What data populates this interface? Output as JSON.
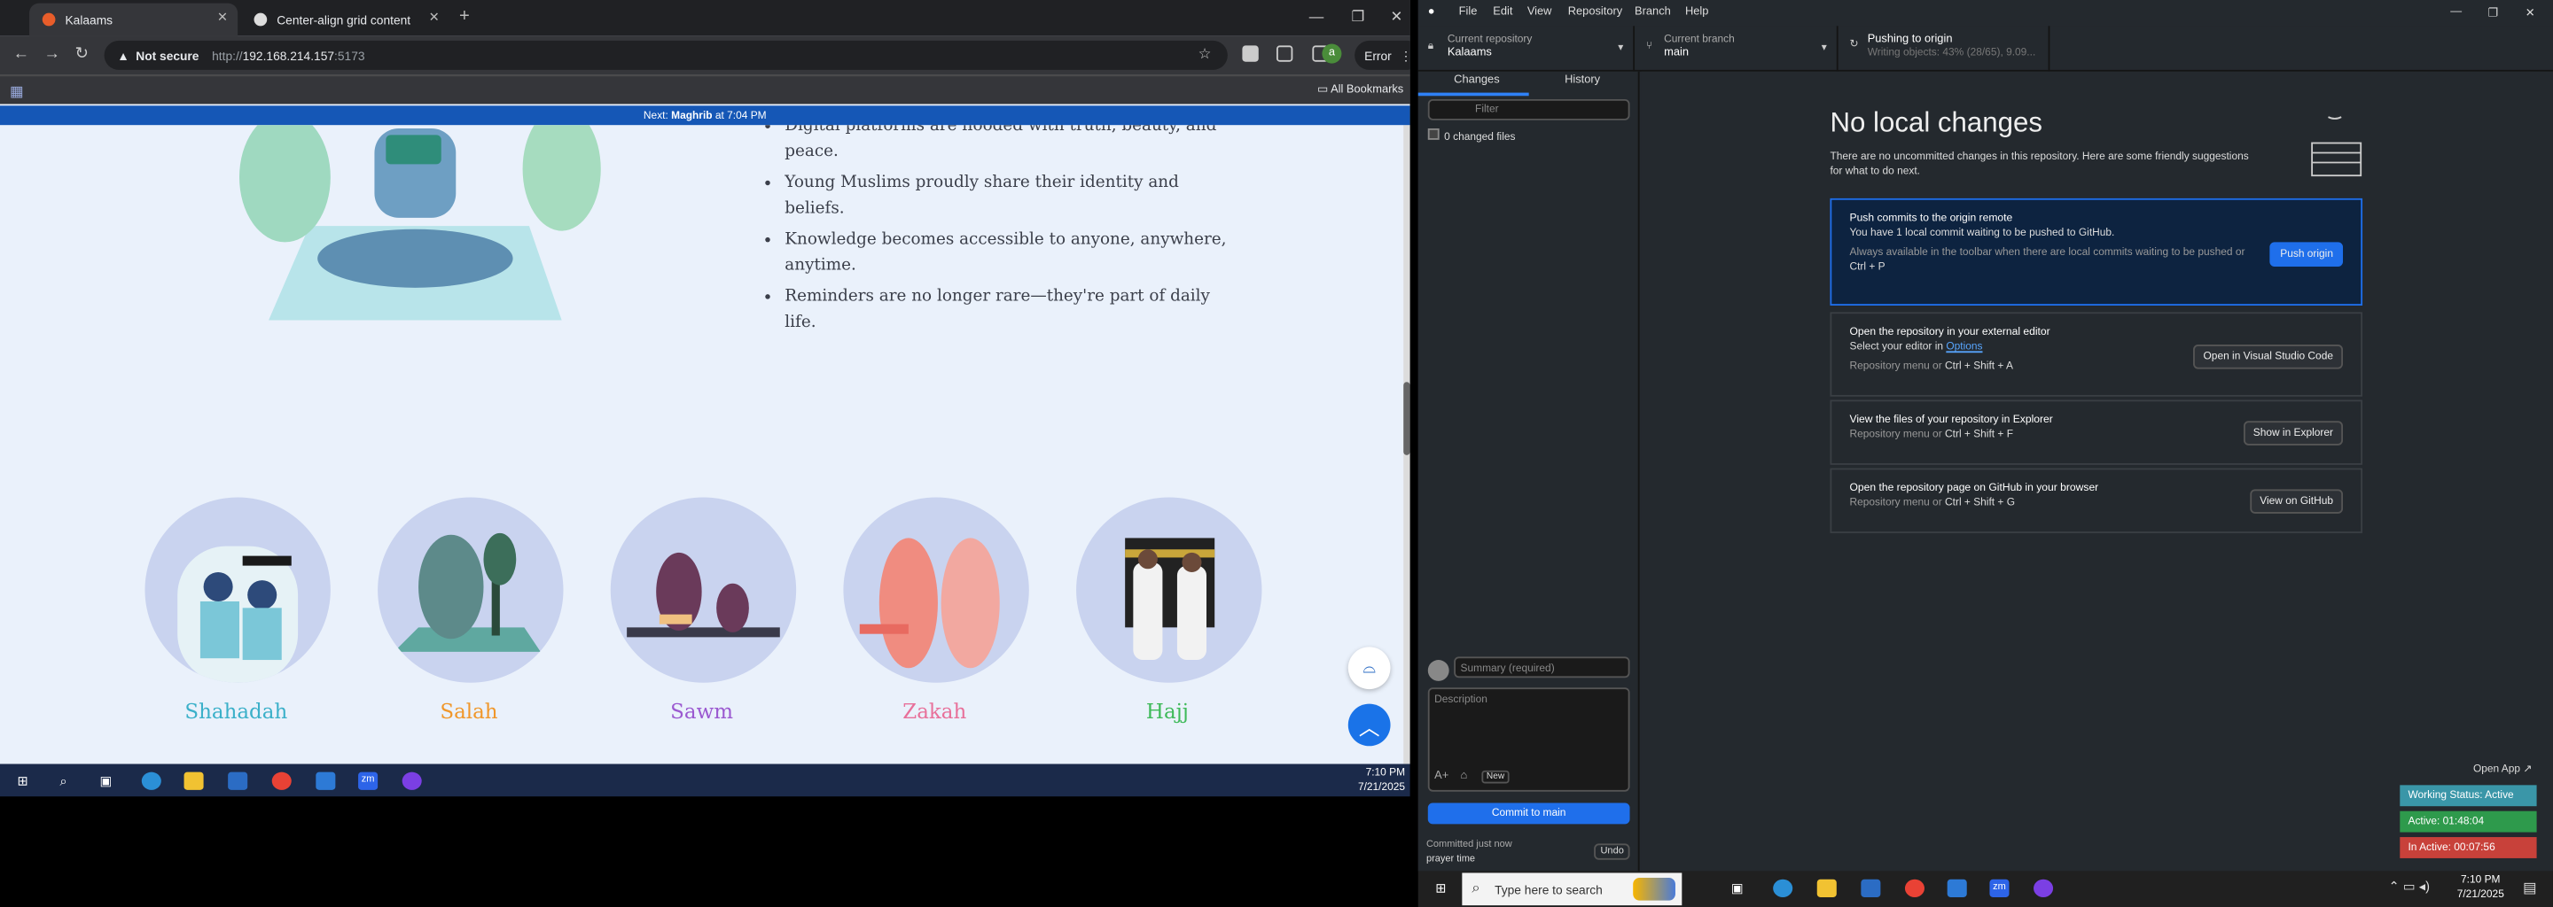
{
  "browser": {
    "tabs": [
      {
        "title": "Kalaams",
        "active": true
      },
      {
        "title": "Center-align grid content",
        "active": false
      }
    ],
    "not_secure": "Not secure",
    "url_prefix": "http://",
    "url_host": "192.168.214.157",
    "url_port": ":5173",
    "error_label": "Error",
    "all_bookmarks": "All Bookmarks",
    "avatar_letter": "a"
  },
  "page": {
    "prayer_banner_prefix": "Next:",
    "prayer_banner_name": "Maghrib",
    "prayer_banner_time": "at 7:04 PM",
    "bullets": [
      "Digital platforms are flooded with truth, beauty, and peace.",
      "Young Muslims proudly share their identity and beliefs.",
      "Knowledge becomes accessible to anyone, anywhere, anytime.",
      "Reminders are no longer rare—they're part of daily life."
    ],
    "pillars": [
      {
        "label": "Shahadah",
        "color": "#3bb0c9"
      },
      {
        "label": "Salah",
        "color": "#f0972a"
      },
      {
        "label": "Sawm",
        "color": "#9b59d0"
      },
      {
        "label": "Zakah",
        "color": "#e8709a"
      },
      {
        "label": "Hajj",
        "color": "#3fba5a"
      }
    ]
  },
  "taskbar_left": {
    "time": "7:10 PM",
    "date": "7/21/2025"
  },
  "github": {
    "menu": [
      "File",
      "Edit",
      "View",
      "Repository",
      "Branch",
      "Help"
    ],
    "repo_label": "Current repository",
    "repo_value": "Kalaams",
    "branch_label": "Current branch",
    "branch_value": "main",
    "push_title": "Pushing to origin",
    "push_sub": "Writing objects: 43% (28/65), 9.09...",
    "tab_changes": "Changes",
    "tab_history": "History",
    "filter_placeholder": "Filter",
    "changed_files": "0 changed files",
    "summary_placeholder": "Summary (required)",
    "description_placeholder": "Description",
    "new_label": "New",
    "commit_button": "Commit to main",
    "committed": "Committed just now",
    "committed_msg": "prayer time",
    "undo": "Undo",
    "no_changes_title": "No local changes",
    "no_changes_sub": "There are no uncommitted changes in this repository. Here are some friendly suggestions for what to do next.",
    "push_card": {
      "title": "Push commits to the origin remote",
      "line1": "You have 1 local commit waiting to be pushed to GitHub.",
      "line2": "Always available in the toolbar when there are local commits waiting to be pushed or",
      "shortcut": "Ctrl + P",
      "button": "Push origin"
    },
    "editor_card": {
      "title": "Open the repository in your external editor",
      "line1": "Select your editor in",
      "link": "Options",
      "sub": "Repository menu or",
      "shortcut": "Ctrl + Shift + A",
      "button": "Open in Visual Studio Code"
    },
    "explorer_card": {
      "title": "View the files of your repository in Explorer",
      "sub": "Repository menu or",
      "shortcut": "Ctrl + Shift + F",
      "button": "Show in Explorer"
    },
    "github_card": {
      "title": "Open the repository page on GitHub in your browser",
      "sub": "Repository menu or",
      "shortcut": "Ctrl + Shift + G",
      "button": "View on GitHub"
    }
  },
  "working": {
    "open_app": "Open App ↗",
    "status": "Working Status: Active",
    "active": "Active: 01:48:04",
    "inactive": "In Active: 00:07:56"
  },
  "taskbar_right": {
    "search_placeholder": "Type here to search",
    "time": "7:10 PM",
    "date": "7/21/2025"
  }
}
